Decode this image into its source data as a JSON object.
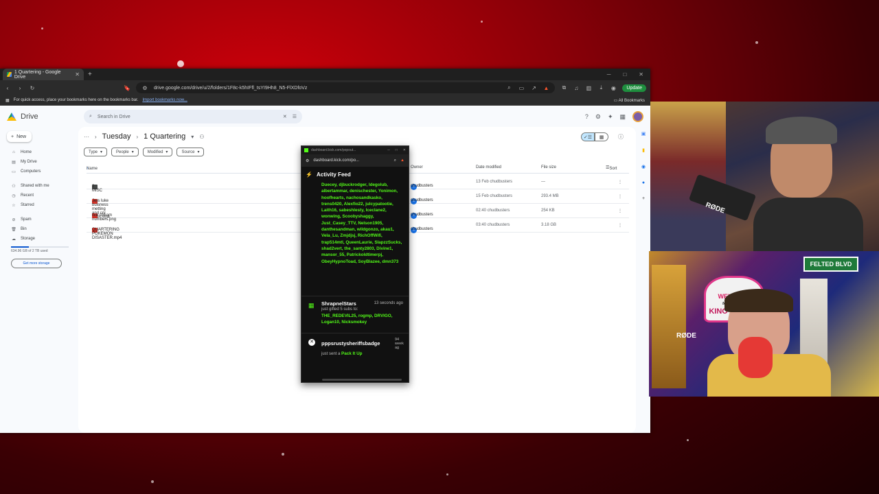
{
  "browser": {
    "tab_title": "1 Quartering - Google Drive",
    "url": "drive.google.com/drive/u/2/folders/1F8c-k5hIFfl_tsYI9Hh8_N5-FlXDfoVz",
    "update_label": "Update",
    "bookmarks_prompt": "For quick access, place your bookmarks here on the bookmarks bar.",
    "import_link": "Import bookmarks now...",
    "all_bookmarks": "All Bookmarks"
  },
  "drive": {
    "app_name": "Drive",
    "search_placeholder": "Search in Drive",
    "new_label": "New",
    "nav": [
      {
        "label": "Home",
        "icon": "home-icon"
      },
      {
        "label": "My Drive",
        "icon": "drive-icon"
      },
      {
        "label": "Computers",
        "icon": "computer-icon"
      },
      {
        "label": "Shared with me",
        "icon": "people-icon"
      },
      {
        "label": "Recent",
        "icon": "clock-icon"
      },
      {
        "label": "Starred",
        "icon": "star-icon"
      },
      {
        "label": "Spam",
        "icon": "spam-icon"
      },
      {
        "label": "Bin",
        "icon": "bin-icon"
      },
      {
        "label": "Storage",
        "icon": "cloud-icon"
      }
    ],
    "storage_used": "634.96 GB of 2 TB used",
    "storage_fraction": 0.31,
    "get_more_storage": "Get more storage",
    "breadcrumb": {
      "parent": "Tuesday",
      "current": "1 Quartering"
    },
    "filters": [
      "Type",
      "People",
      "Modified",
      "Source"
    ],
    "columns": {
      "name": "Name",
      "owner": "Owner",
      "modified": "Date modified",
      "size": "File size",
      "sort": "Sort"
    },
    "files": [
      {
        "name": "2 MISC",
        "type": "folder",
        "owner": "chudbusters",
        "modified": "13 Feb chudbusters",
        "size": "—"
      },
      {
        "name": "Jers luke buisness metting and cry sesh.mp4",
        "type": "video",
        "owner": "chudbusters",
        "modified": "15 Feb chudbusters",
        "size": "293.4 MB"
      },
      {
        "name": "live stream numbers.png",
        "type": "image",
        "owner": "chudbusters",
        "modified": "02:40 chudbusters",
        "size": "254 KB"
      },
      {
        "name": "QUARTERING POKEMON DISASTER.mp4",
        "type": "video",
        "owner": "chudbusters",
        "modified": "03:40 chudbusters",
        "size": "3.18 GB"
      }
    ]
  },
  "kick": {
    "window_title": "dashboard.kick.com/popout...",
    "url": "dashboard.kick.com/po...",
    "feed_title": "Activity Feed",
    "names": "Duecey, djbuckrodger, ldegolub, albertammar, denischester, Yonimon, hoofhearts, nachosandkasko, trens0420, Alexfio22, julcypatootie, Laith16, sabeshlesty, Iceclane2, wonwing, Scoobyshaggy, Just_Casey_TTV, Nelson1905, danthesandman, wildgonzo, akau1, Vela_Lu, Zmjdjsj, RichOffWifi, trap514mtl, QueenLaurie, SlapzzSucks, shad2vert, the_santy2803, Divine1, mansor_55, Patrickoldtimerpj, ObeyHypnoToad, SoyBlazee, dmn373",
    "event1": {
      "user": "ShrapnelStars",
      "time": "13 seconds ago",
      "text": "just gifted 5 subs to:",
      "recipients": "THE_REDEVIL25, rogmp, DRVIGO, Logan10, Nicksmokey"
    },
    "event2": {
      "user": "pppsrustysheriffsbadge",
      "time": "94 week ag",
      "text": "just sent a",
      "item": "Pack It Up"
    }
  },
  "stream": {
    "sign_welcome": "WELCOME",
    "sign_sub": "to Fabulous",
    "sign_casino": "KINO CASINO",
    "street_sign": "FELTED BLVD",
    "mic_brand": "RØDE"
  }
}
